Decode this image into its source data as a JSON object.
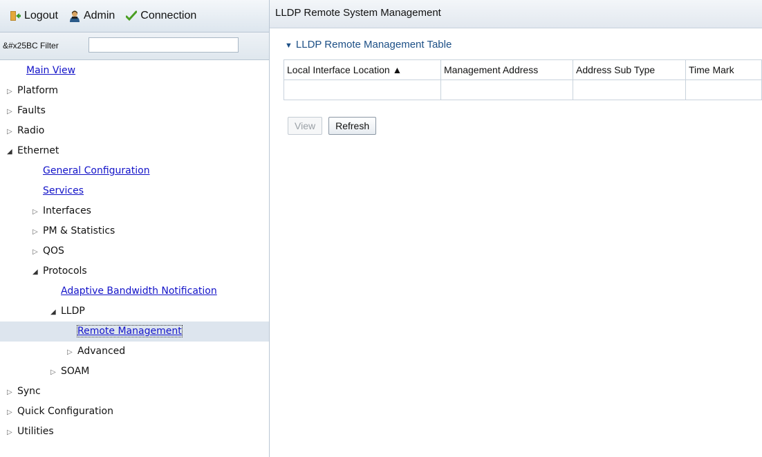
{
  "toolbar": {
    "logout": "Logout",
    "admin": "Admin",
    "connection": "Connection"
  },
  "filter": {
    "label": "&#x25BC Filter",
    "value": "",
    "clear_icon": "×"
  },
  "tree": {
    "main_view": "Main View",
    "platform": "Platform",
    "faults": "Faults",
    "radio": "Radio",
    "ethernet": "Ethernet",
    "general_configuration": "General Configuration",
    "services": "Services",
    "interfaces": "Interfaces",
    "pm_statistics": "PM & Statistics",
    "qos": "QOS",
    "protocols": "Protocols",
    "adaptive_bandwidth": "Adaptive Bandwidth Notification",
    "lldp": "LLDP",
    "remote_management": "Remote Management",
    "advanced": "Advanced",
    "soam": "SOAM",
    "sync": "Sync",
    "quick_configuration": "Quick Configuration",
    "utilities": "Utilities",
    "collapsed_glyph": "▷",
    "expanded_glyph": "◢"
  },
  "main": {
    "title": "LLDP Remote System Management",
    "table_title": "LLDP Remote Management Table",
    "table_title_arrow": "▼",
    "columns": {
      "local_interface": "Local Interface Location ▲",
      "management_address": "Management Address",
      "address_sub_type": "Address Sub Type",
      "time_mark": "Time Mark"
    },
    "buttons": {
      "view": "View",
      "refresh": "Refresh"
    }
  },
  "colors": {
    "link": "#1212c8",
    "table_title": "#1c4f86",
    "selected_row": "#dde5ee",
    "panel_border": "#b9c6d3"
  },
  "icons": {
    "logout": "door-exit-icon",
    "admin": "user-icon",
    "connection": "checkmark-icon"
  }
}
